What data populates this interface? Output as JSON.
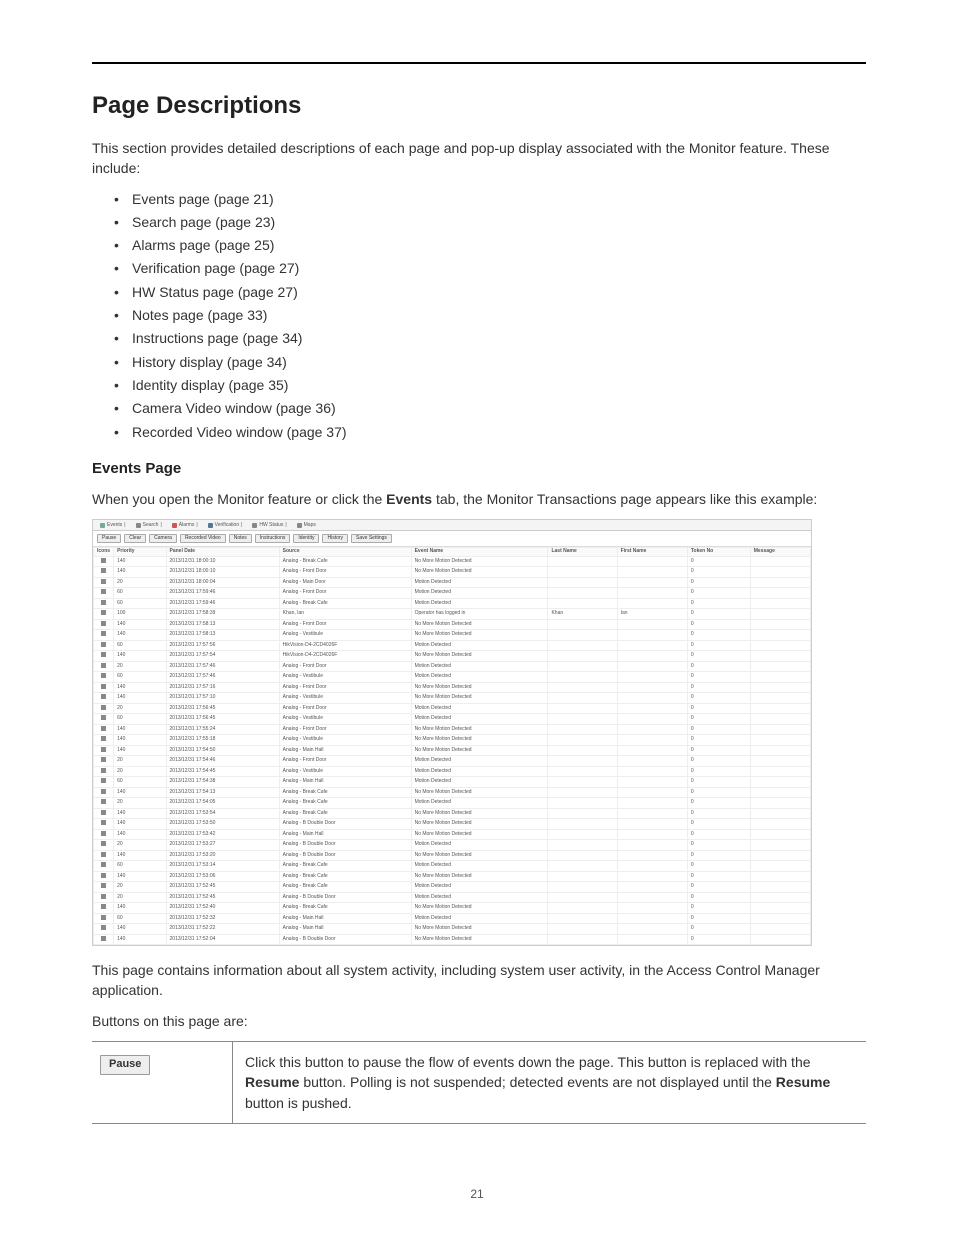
{
  "heading": "Page Descriptions",
  "intro": "This section provides detailed descriptions of each page and pop-up display associated with the Monitor feature. These include:",
  "bullets": [
    "Events page (page 21)",
    "Search page (page 23)",
    "Alarms page (page 25)",
    "Verification page (page 27)",
    "HW Status page (page 27)",
    "Notes page (page 33)",
    "Instructions page (page 34)",
    "History display (page 34)",
    "Identity display (page 35)",
    "Camera Video window (page 36)",
    "Recorded Video window (page 37)"
  ],
  "sub_heading": "Events Page",
  "events_para_pre": "When you open the Monitor feature or click the ",
  "events_para_bold": "Events",
  "events_para_post": " tab, the Monitor Transactions page appears like this example:",
  "after_screenshot_p1": "This page contains information about all system activity, including system user activity, in the Access Control Manager application.",
  "after_screenshot_p2": "Buttons on this page are:",
  "pause_btn_label": "Pause",
  "pause_desc_pre": "Click this button to pause the flow of events down the page. This button is replaced with the ",
  "pause_desc_b1": "Resume",
  "pause_desc_mid": " button. Polling is not suspended; detected events are not displayed until the ",
  "pause_desc_b2": "Resume",
  "pause_desc_post": " button is pushed.",
  "screenshot": {
    "tabs": [
      "Events",
      "Search",
      "Alarms",
      "Verification",
      "HW Status",
      "Maps"
    ],
    "toolbar": [
      "Pause",
      "Clear",
      "Camera",
      "Recorded Video",
      "Notes",
      "Instructions",
      "Identity",
      "History",
      "Save Settings"
    ],
    "columns": [
      "Icons",
      "Priority",
      "Panel Date",
      "Source",
      "Event Name",
      "Last Name",
      "First Name",
      "Token No",
      "Message"
    ],
    "rows": [
      {
        "pri": "140",
        "date": "2013/12/31 18:00:10",
        "src": "Analog - Break Cafe",
        "ev": "No More Motion Detected",
        "ln": "",
        "fn": "",
        "tk": "0",
        "msg": ""
      },
      {
        "pri": "140",
        "date": "2013/12/31 18:00:10",
        "src": "Analog - Front Door",
        "ev": "No More Motion Detected",
        "ln": "",
        "fn": "",
        "tk": "0",
        "msg": ""
      },
      {
        "pri": "20",
        "date": "2013/12/31 18:00:04",
        "src": "Analog - Main Door",
        "ev": "Motion Detected",
        "ln": "",
        "fn": "",
        "tk": "0",
        "msg": ""
      },
      {
        "pri": "60",
        "date": "2013/12/31 17:59:46",
        "src": "Analog - Front Door",
        "ev": "Motion Detected",
        "ln": "",
        "fn": "",
        "tk": "0",
        "msg": ""
      },
      {
        "pri": "60",
        "date": "2013/12/31 17:59:46",
        "src": "Analog - Break Cafe",
        "ev": "Motion Detected",
        "ln": "",
        "fn": "",
        "tk": "0",
        "msg": ""
      },
      {
        "pri": "100",
        "date": "2013/12/31 17:58:39",
        "src": "Khan, Ian",
        "ev": "Operator has logged in",
        "ln": "Khan",
        "fn": "Ian",
        "tk": "0",
        "msg": ""
      },
      {
        "pri": "140",
        "date": "2013/12/31 17:58:13",
        "src": "Analog - Front Door",
        "ev": "No More Motion Detected",
        "ln": "",
        "fn": "",
        "tk": "0",
        "msg": ""
      },
      {
        "pri": "140",
        "date": "2013/12/31 17:58:13",
        "src": "Analog - Vestibule",
        "ev": "No More Motion Detected",
        "ln": "",
        "fn": "",
        "tk": "0",
        "msg": ""
      },
      {
        "pri": "60",
        "date": "2013/12/31 17:57:56",
        "src": "HikVision-D4-2CD4026F",
        "ev": "Motion Detected",
        "ln": "",
        "fn": "",
        "tk": "0",
        "msg": ""
      },
      {
        "pri": "140",
        "date": "2013/12/31 17:57:54",
        "src": "HikVision-D4-2CD4026F",
        "ev": "No More Motion Detected",
        "ln": "",
        "fn": "",
        "tk": "0",
        "msg": ""
      },
      {
        "pri": "20",
        "date": "2013/12/31 17:57:46",
        "src": "Analog - Front Door",
        "ev": "Motion Detected",
        "ln": "",
        "fn": "",
        "tk": "0",
        "msg": ""
      },
      {
        "pri": "60",
        "date": "2013/12/31 17:57:46",
        "src": "Analog - Vestibule",
        "ev": "Motion Detected",
        "ln": "",
        "fn": "",
        "tk": "0",
        "msg": ""
      },
      {
        "pri": "140",
        "date": "2013/12/31 17:57:16",
        "src": "Analog - Front Door",
        "ev": "No More Motion Detected",
        "ln": "",
        "fn": "",
        "tk": "0",
        "msg": ""
      },
      {
        "pri": "140",
        "date": "2013/12/31 17:57:10",
        "src": "Analog - Vestibule",
        "ev": "No More Motion Detected",
        "ln": "",
        "fn": "",
        "tk": "0",
        "msg": ""
      },
      {
        "pri": "20",
        "date": "2013/12/31 17:56:45",
        "src": "Analog - Front Door",
        "ev": "Motion Detected",
        "ln": "",
        "fn": "",
        "tk": "0",
        "msg": ""
      },
      {
        "pri": "60",
        "date": "2013/12/31 17:56:45",
        "src": "Analog - Vestibule",
        "ev": "Motion Detected",
        "ln": "",
        "fn": "",
        "tk": "0",
        "msg": ""
      },
      {
        "pri": "140",
        "date": "2013/12/31 17:55:24",
        "src": "Analog - Front Door",
        "ev": "No More Motion Detected",
        "ln": "",
        "fn": "",
        "tk": "0",
        "msg": ""
      },
      {
        "pri": "140",
        "date": "2013/12/31 17:55:18",
        "src": "Analog - Vestibule",
        "ev": "No More Motion Detected",
        "ln": "",
        "fn": "",
        "tk": "0",
        "msg": ""
      },
      {
        "pri": "140",
        "date": "2013/12/31 17:54:50",
        "src": "Analog - Main Hall",
        "ev": "No More Motion Detected",
        "ln": "",
        "fn": "",
        "tk": "0",
        "msg": ""
      },
      {
        "pri": "20",
        "date": "2013/12/31 17:54:46",
        "src": "Analog - Front Door",
        "ev": "Motion Detected",
        "ln": "",
        "fn": "",
        "tk": "0",
        "msg": ""
      },
      {
        "pri": "20",
        "date": "2013/12/31 17:54:45",
        "src": "Analog - Vestibule",
        "ev": "Motion Detected",
        "ln": "",
        "fn": "",
        "tk": "0",
        "msg": ""
      },
      {
        "pri": "60",
        "date": "2013/12/31 17:54:38",
        "src": "Analog - Main Hall",
        "ev": "Motion Detected",
        "ln": "",
        "fn": "",
        "tk": "0",
        "msg": ""
      },
      {
        "pri": "140",
        "date": "2013/12/31 17:54:13",
        "src": "Analog - Break Cafe",
        "ev": "No More Motion Detected",
        "ln": "",
        "fn": "",
        "tk": "0",
        "msg": ""
      },
      {
        "pri": "20",
        "date": "2013/12/31 17:54:05",
        "src": "Analog - Break Cafe",
        "ev": "Motion Detected",
        "ln": "",
        "fn": "",
        "tk": "0",
        "msg": ""
      },
      {
        "pri": "140",
        "date": "2013/12/31 17:53:54",
        "src": "Analog - Break Cafe",
        "ev": "No More Motion Detected",
        "ln": "",
        "fn": "",
        "tk": "0",
        "msg": ""
      },
      {
        "pri": "140",
        "date": "2013/12/31 17:53:50",
        "src": "Analog - B Double Door",
        "ev": "No More Motion Detected",
        "ln": "",
        "fn": "",
        "tk": "0",
        "msg": ""
      },
      {
        "pri": "140",
        "date": "2013/12/31 17:53:42",
        "src": "Analog - Main Hall",
        "ev": "No More Motion Detected",
        "ln": "",
        "fn": "",
        "tk": "0",
        "msg": ""
      },
      {
        "pri": "20",
        "date": "2013/12/31 17:53:27",
        "src": "Analog - B Double Door",
        "ev": "Motion Detected",
        "ln": "",
        "fn": "",
        "tk": "0",
        "msg": ""
      },
      {
        "pri": "140",
        "date": "2013/12/31 17:53:20",
        "src": "Analog - B Double Door",
        "ev": "No More Motion Detected",
        "ln": "",
        "fn": "",
        "tk": "0",
        "msg": ""
      },
      {
        "pri": "60",
        "date": "2013/12/31 17:53:14",
        "src": "Analog - Break Cafe",
        "ev": "Motion Detected",
        "ln": "",
        "fn": "",
        "tk": "0",
        "msg": ""
      },
      {
        "pri": "140",
        "date": "2013/12/31 17:53:06",
        "src": "Analog - Break Cafe",
        "ev": "No More Motion Detected",
        "ln": "",
        "fn": "",
        "tk": "0",
        "msg": ""
      },
      {
        "pri": "20",
        "date": "2013/12/31 17:52:45",
        "src": "Analog - Break Cafe",
        "ev": "Motion Detected",
        "ln": "",
        "fn": "",
        "tk": "0",
        "msg": ""
      },
      {
        "pri": "20",
        "date": "2013/12/31 17:52:45",
        "src": "Analog - B Double Door",
        "ev": "Motion Detected",
        "ln": "",
        "fn": "",
        "tk": "0",
        "msg": ""
      },
      {
        "pri": "140",
        "date": "2013/12/31 17:52:40",
        "src": "Analog - Break Cafe",
        "ev": "No More Motion Detected",
        "ln": "",
        "fn": "",
        "tk": "0",
        "msg": ""
      },
      {
        "pri": "60",
        "date": "2013/12/31 17:52:32",
        "src": "Analog - Main Hall",
        "ev": "Motion Detected",
        "ln": "",
        "fn": "",
        "tk": "0",
        "msg": ""
      },
      {
        "pri": "140",
        "date": "2013/12/31 17:52:22",
        "src": "Analog - Main Hall",
        "ev": "No More Motion Detected",
        "ln": "",
        "fn": "",
        "tk": "0",
        "msg": ""
      },
      {
        "pri": "140",
        "date": "2013/12/31 17:52:04",
        "src": "Analog - B Double Door",
        "ev": "No More Motion Detected",
        "ln": "",
        "fn": "",
        "tk": "0",
        "msg": ""
      }
    ]
  },
  "page_number": "21"
}
